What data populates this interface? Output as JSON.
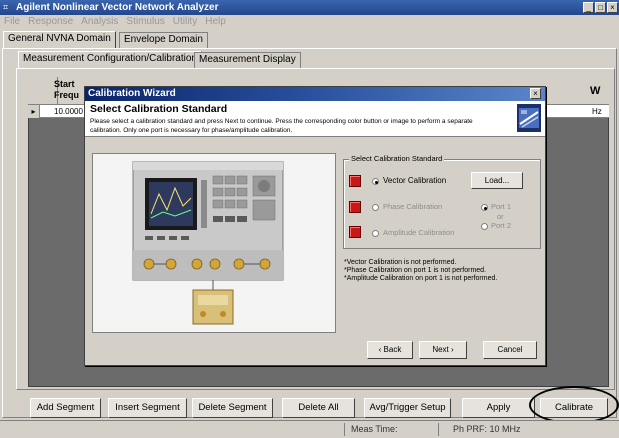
{
  "window": {
    "title": "Agilent Nonlinear Vector Network Analyzer",
    "controls": [
      "minimize-icon",
      "maximize-icon",
      "close-icon"
    ]
  },
  "menu": [
    "File",
    "Response",
    "Analysis",
    "Stimulus",
    "Utility",
    "Help"
  ],
  "top_tabs": [
    "General NVNA Domain",
    "Envelope Domain"
  ],
  "sub_tabs": [
    "Measurement Configuration/Calibration",
    "Measurement Display"
  ],
  "grid": {
    "header_start": "Start",
    "header_freq": "Frequ",
    "header_right": "W",
    "row_marker": "▸",
    "row_value": "10.0000",
    "row_right": "Hz"
  },
  "dialog": {
    "title": "Calibration Wizard",
    "heading": "Select Calibration Standard",
    "instructions": "Please select a calibration standard and press Next to continue. Press the corresponding color button or image to perform a separate calibration. Only one port is necessary for phase/amplitude calibration.",
    "group_title": "Select Calibration Standard",
    "options": {
      "vector": "Vector Calibration",
      "phase": "Phase Calibration",
      "amplitude": "Amplitude Calibration"
    },
    "load_label": "Load...",
    "port1": "Port 1",
    "or": "or",
    "port2": "Port 2",
    "status": [
      "*Vector Calibration is not performed.",
      "*Phase Calibration on port 1 is not performed.",
      "*Amplitude Calibration on port 1 is not performed."
    ],
    "back_label": "‹ Back",
    "next_label": "Next ›",
    "cancel_label": "Cancel"
  },
  "bottom_buttons": {
    "add_segment": "Add Segment",
    "insert_segment": "Insert Segment",
    "delete_segment": "Delete Segment",
    "delete_all": "Delete All",
    "avg_trigger": "Avg/Trigger Setup",
    "apply": "Apply",
    "calibrate": "Calibrate"
  },
  "status_bar": {
    "meas_time": "Meas Time:",
    "ph_prf": "Ph PRF: 10 MHz"
  },
  "colors": {
    "title_bar": "#23468c",
    "dialog_title": "#0a246a",
    "calibration_button": "#c81818",
    "grid_background": "#6b6b6b"
  }
}
